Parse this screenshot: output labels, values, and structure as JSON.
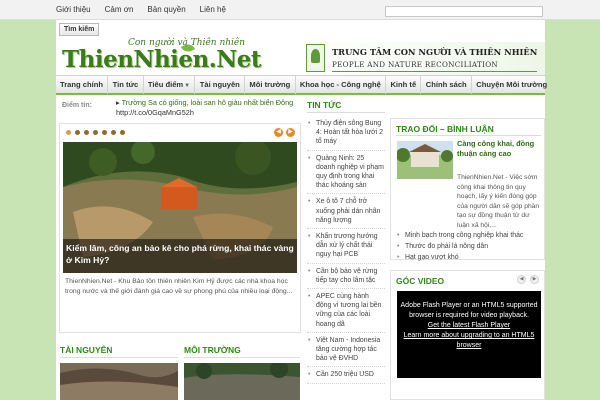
{
  "topbar": {
    "links": [
      "Giới thiệu",
      "Cảm ơn",
      "Bản quyền",
      "Liên hệ"
    ],
    "search_placeholder": ""
  },
  "search_button": "Tìm kiếm",
  "logo": {
    "slogan": "Con người và Thiên nhiên",
    "name": "ThienNhien.Net"
  },
  "banner": {
    "emblem_text": "PeopleNature",
    "title": "TRUNG TÂM CON NGƯỜI VÀ THIÊN NHIÊN",
    "subtitle": "PEOPLE AND NATURE RECONCILIATION"
  },
  "nav": {
    "items": [
      "Trang chính",
      "Tin tức",
      "Tiêu điểm",
      "Tài nguyên",
      "Môi trường",
      "Khoa học - Công nghệ",
      "Kinh tế",
      "Chính sách",
      "Chuyện Môi trường"
    ],
    "dropdown_index": 2
  },
  "ticker": {
    "label": "Điểm tin:",
    "text": "Trường Sa có giống, loài san hô giàu nhất biển Đông",
    "link": "http://t.co/0GqaMnG52h"
  },
  "slider": {
    "dots": 7,
    "caption": "Kiểm lâm, công an bảo kê cho phá rừng, khai thác vàng ở Kim Hỷ?",
    "description": "ThienNhien.Net - Khu Bảo tồn thiên nhiên Kim Hỷ được các nhà khoa học trong nước và thế giới đánh giá cao về sự phong phú của nhiều loại động..."
  },
  "sections": {
    "tai_nguyen": "TÀI NGUYÊN",
    "moi_truong": "MÔI TRƯỜNG",
    "tin_tuc": "TIN TỨC",
    "trao_doi": "TRAO ĐỔI – BÌNH LUẬN",
    "goc_video": "GÓC VIDEO"
  },
  "tin_tuc": [
    "Thủy điện sông Bung 4: Hoàn tất hòa lưới 2 tổ máy",
    "Quảng Ninh: 25 doanh nghiệp vi phạm quy định trong khai thác khoáng sản",
    "Xe ô tô 7 chỗ trở xuống phải dán nhãn năng lượng",
    "Khẩn trương hướng dẫn xử lý chất thải nguy hại PCB",
    "Cần bộ bảo vệ rừng tiếp tay cho lâm tặc",
    "APEC cùng hành động vì tương lai bền vững của các loài hoang dã",
    "Việt Nam - Indonesia tăng cường hợp tác bảo vệ ĐVHD",
    "Cần 250 triệu USD"
  ],
  "trao_doi": {
    "title": "Càng công khai, đồng thuận càng cao",
    "text": "ThienNhien.Net - Việc sớm công khai thông tin quy hoạch, lấy ý kiến đóng góp của người dân sẽ góp phần tạo sự đồng thuận từ dư luận xã hội,...",
    "links": [
      "Minh bạch trong công nghiệp khai thác",
      "Thước đo phải là nông dân",
      "Hạt gạo vượt khó"
    ]
  },
  "video": {
    "line1": "Adobe Flash Player or an HTML5 supported browser is required for video playback.",
    "link1": "Get the latest Flash Player",
    "link2": "Learn more about upgrading to an HTML5 browser"
  },
  "colors": {
    "background": "#c9e4b4",
    "accent_green": "#2f8a14",
    "nav_underline": "#7dbb3c",
    "slider_arrows": "#e58a2a"
  }
}
